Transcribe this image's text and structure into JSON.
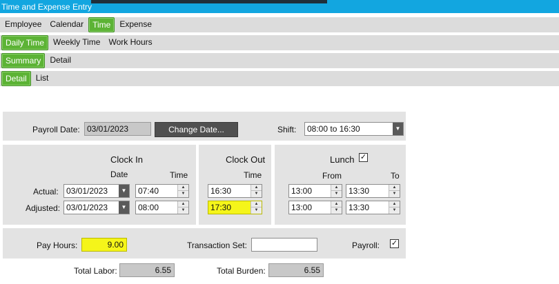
{
  "window": {
    "title": "Time and Expense Entry"
  },
  "tabs_main": [
    "Employee",
    "Calendar",
    "Time",
    "Expense"
  ],
  "tabs_time": [
    "Daily Time",
    "Weekly Time",
    "Work Hours"
  ],
  "tabs_daily": [
    "Summary",
    "Detail"
  ],
  "tabs_summary": [
    "Detail",
    "List"
  ],
  "header": {
    "payroll_date_label": "Payroll Date:",
    "payroll_date_value": "03/01/2023",
    "change_date_button": "Change Date...",
    "shift_label": "Shift:",
    "shift_value": "08:00 to 16:30"
  },
  "clock_in": {
    "title": "Clock In",
    "date_header": "Date",
    "time_header": "Time",
    "actual_label": "Actual:",
    "adjusted_label": "Adjusted:",
    "actual_date": "03/01/2023",
    "actual_time": "07:40",
    "adjusted_date": "03/01/2023",
    "adjusted_time": "08:00"
  },
  "clock_out": {
    "title": "Clock Out",
    "time_header": "Time",
    "actual_time": "16:30",
    "adjusted_time": "17:30"
  },
  "lunch": {
    "title": "Lunch",
    "checked_mark": "✓",
    "from_header": "From",
    "to_header": "To",
    "actual_from": "13:00",
    "actual_to": "13:30",
    "adjusted_from": "13:00",
    "adjusted_to": "13:30"
  },
  "pay": {
    "pay_hours_label": "Pay Hours:",
    "pay_hours_value": "9.00",
    "transaction_set_label": "Transaction Set:",
    "transaction_set_value": "",
    "payroll_label": "Payroll:",
    "payroll_checked_mark": "✓"
  },
  "totals": {
    "total_labor_label": "Total Labor:",
    "total_labor_value": "6.55",
    "total_burden_label": "Total Burden:",
    "total_burden_value": "6.55"
  },
  "colors": {
    "title_bar": "#12a6e0",
    "active_tab": "#5cb335",
    "highlight_field": "#f5f51a",
    "panel_bg": "#e3e3e3"
  }
}
